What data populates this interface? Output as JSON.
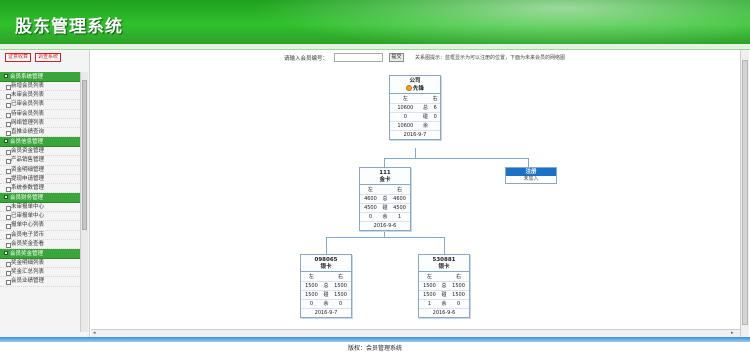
{
  "app": {
    "title": "股东管理系统"
  },
  "sidebar": {
    "tabs": [
      "证意收算",
      "调查系统"
    ],
    "sections": [
      {
        "title": "会员系统管理",
        "items": [
          "新增会员列表",
          "未审会员列表",
          "已审会员列表",
          "待审会员列表",
          "网络管理列表",
          "直推业绩查询"
        ]
      },
      {
        "title": "会员信息管理",
        "items": [
          "会员资金管理",
          "产品销售管理",
          "资金明细管理",
          "提现申请管理",
          "系统参数管理"
        ]
      },
      {
        "title": "会员财务管理",
        "items": [
          "未审报单中心",
          "已审报单中心",
          "报单中心列表",
          "会员电子货币",
          "会员奖金查看"
        ]
      },
      {
        "title": "会员奖金管理",
        "items": [
          "奖金明细列表",
          "奖金汇总列表",
          "会员业绩管理"
        ]
      }
    ]
  },
  "search": {
    "label": "请输入会员编号：",
    "value": "",
    "button": "提交",
    "hint": "关系图提示：蓝框显示为可以注册的位置，下面为未来会员的网络图"
  },
  "tree": {
    "root": {
      "title": "公司",
      "level": "先锋",
      "left": "10600",
      "right": "6",
      "left_label": "左",
      "right_label": "右",
      "mid1": "总",
      "mid2": "碰",
      "mid3": "余",
      "l2": "0",
      "r2": "0",
      "l3": "10600",
      "r3": "",
      "date": "2016-9-7"
    },
    "mid": {
      "title": "111",
      "level": "金卡",
      "l1": "4600",
      "r1": "4600",
      "l2": "4500",
      "r2": "4500",
      "l3": "0",
      "r3": "1",
      "date": "2016-9-6"
    },
    "register": {
      "label": "注册",
      "sub": "未加入"
    },
    "left_child": {
      "title": "098065",
      "level": "银卡",
      "l1": "1500",
      "r1": "1500",
      "l2": "1500",
      "r2": "1500",
      "l3": "0",
      "r3": "0",
      "date": "2016-9-7"
    },
    "right_child": {
      "title": "530881",
      "level": "银卡",
      "l1": "1500",
      "r1": "1500",
      "l2": "1500",
      "r2": "1500",
      "l3": "1",
      "r3": "0",
      "date": "2016-9-6"
    }
  },
  "footer": {
    "text": "版权：会员管理系统"
  }
}
